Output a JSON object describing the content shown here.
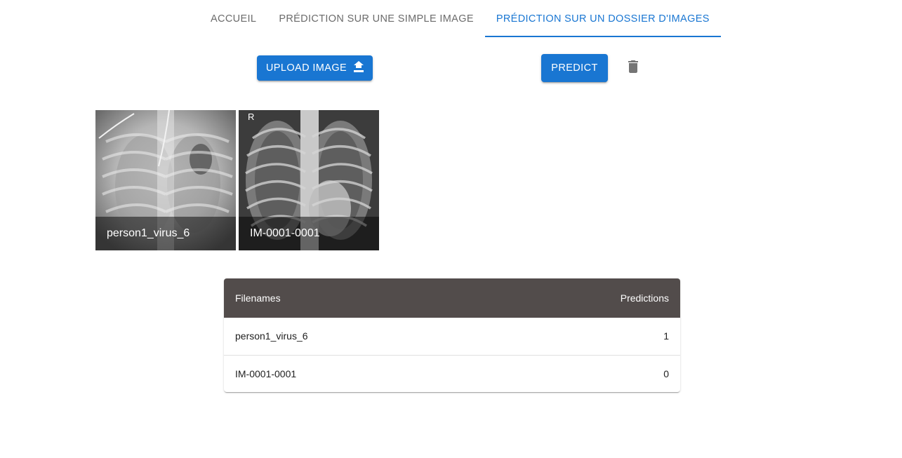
{
  "tabs": [
    {
      "label": "Accueil"
    },
    {
      "label": "Prédiction sur une simple image"
    },
    {
      "label": "Prédiction sur un dossier d'images"
    }
  ],
  "active_tab": 2,
  "toolbar": {
    "upload_label": "UPLOAD IMAGE",
    "upload_icon": "upload-icon",
    "predict_label": "PREDICT",
    "delete_icon": "trash-icon"
  },
  "images": [
    {
      "title": "person1_virus_6"
    },
    {
      "title": "IM-0001-0001",
      "corner_mark": "R"
    }
  ],
  "table": {
    "headers": {
      "filename": "Filenames",
      "prediction": "Predictions"
    },
    "rows": [
      {
        "filename": "person1_virus_6",
        "prediction": "1"
      },
      {
        "filename": "IM-0001-0001",
        "prediction": "0"
      }
    ]
  },
  "colors": {
    "primary": "#1976d2",
    "table_header": "#524c4b",
    "icon": "#757575"
  }
}
